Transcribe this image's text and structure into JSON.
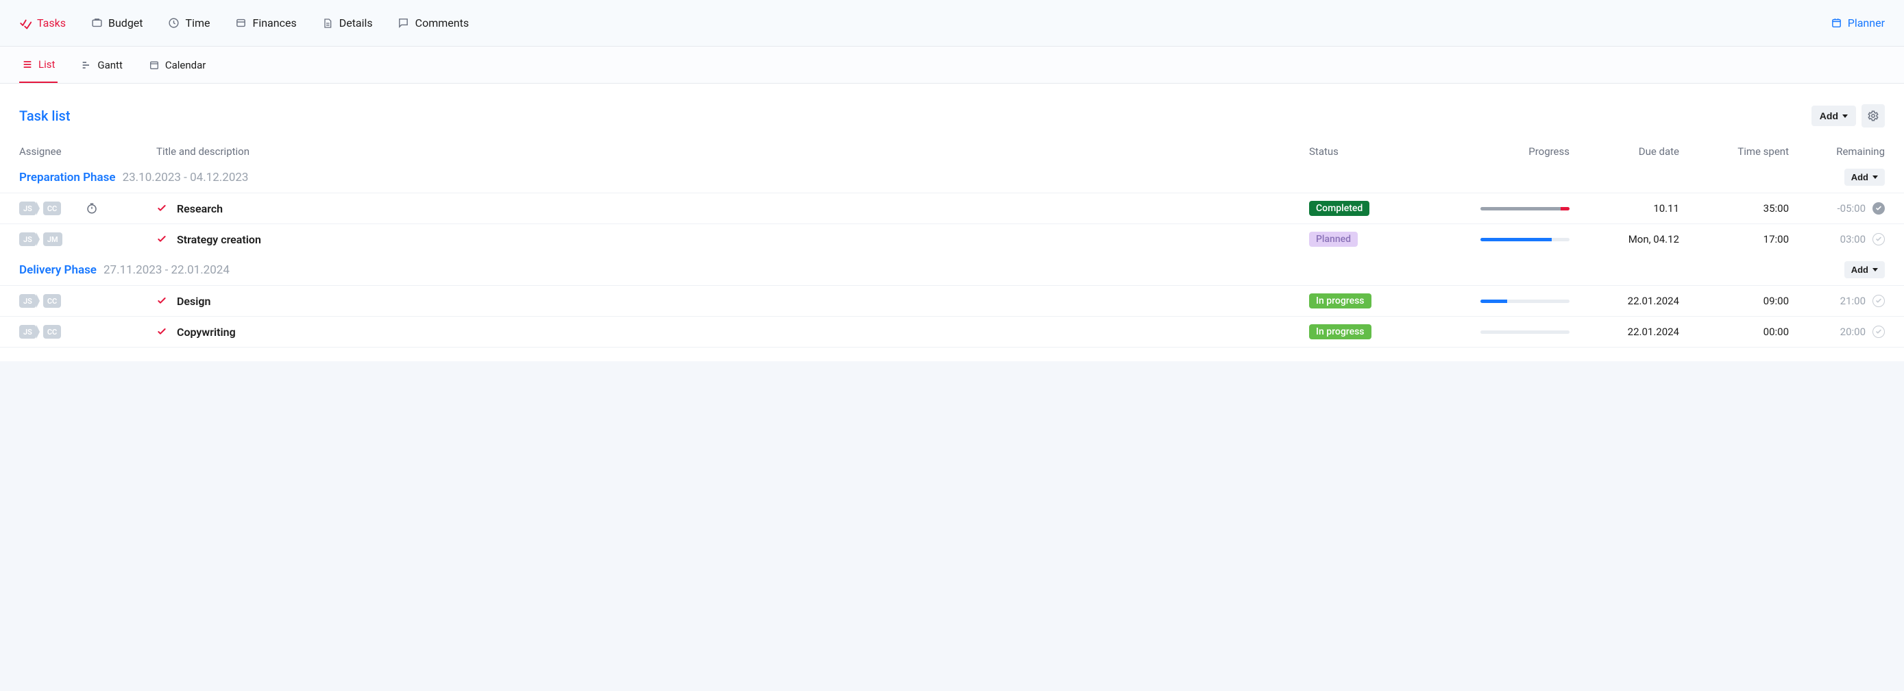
{
  "top_tabs": {
    "tasks": "Tasks",
    "budget": "Budget",
    "time": "Time",
    "finances": "Finances",
    "details": "Details",
    "comments": "Comments",
    "planner": "Planner"
  },
  "sub_tabs": {
    "list": "List",
    "gantt": "Gantt",
    "calendar": "Calendar"
  },
  "tasklist_title": "Task list",
  "add_label": "Add",
  "columns": {
    "assignee": "Assignee",
    "title": "Title and description",
    "status": "Status",
    "progress": "Progress",
    "due_date": "Due date",
    "time_spent": "Time spent",
    "remaining": "Remaining"
  },
  "phases": [
    {
      "name": "Preparation Phase",
      "dates": "23.10.2023 - 04.12.2023",
      "tasks": [
        {
          "a1": "JS",
          "a2": "CC",
          "has_timer": true,
          "title": "Research",
          "status_label": "Completed",
          "status_class": "status-completed",
          "progress_fill": 95,
          "progress_fill_class": "fill",
          "progress_over": 10,
          "due": "10.11",
          "spent": "35:00",
          "remain": "-05:00",
          "remain_muted": true,
          "done": true
        },
        {
          "a1": "JS",
          "a2": "JM",
          "has_timer": false,
          "title": "Strategy creation",
          "status_label": "Planned",
          "status_class": "status-planned",
          "progress_fill": 80,
          "progress_fill_class": "fill blue",
          "progress_over": 0,
          "due": "Mon, 04.12",
          "spent": "17:00",
          "remain": "03:00",
          "remain_muted": true,
          "done": false
        }
      ]
    },
    {
      "name": "Delivery Phase",
      "dates": "27.11.2023 - 22.01.2024",
      "tasks": [
        {
          "a1": "JS",
          "a2": "CC",
          "has_timer": false,
          "title": "Design",
          "status_label": "In progress",
          "status_class": "status-inprogress",
          "progress_fill": 30,
          "progress_fill_class": "fill blue",
          "progress_over": 0,
          "due": "22.01.2024",
          "spent": "09:00",
          "remain": "21:00",
          "remain_muted": true,
          "done": false
        },
        {
          "a1": "JS",
          "a2": "CC",
          "has_timer": false,
          "title": "Copywriting",
          "status_label": "In progress",
          "status_class": "status-inprogress",
          "progress_fill": 0,
          "progress_fill_class": "fill blue",
          "progress_over": 0,
          "due": "22.01.2024",
          "spent": "00:00",
          "remain": "20:00",
          "remain_muted": true,
          "done": false
        }
      ]
    }
  ]
}
